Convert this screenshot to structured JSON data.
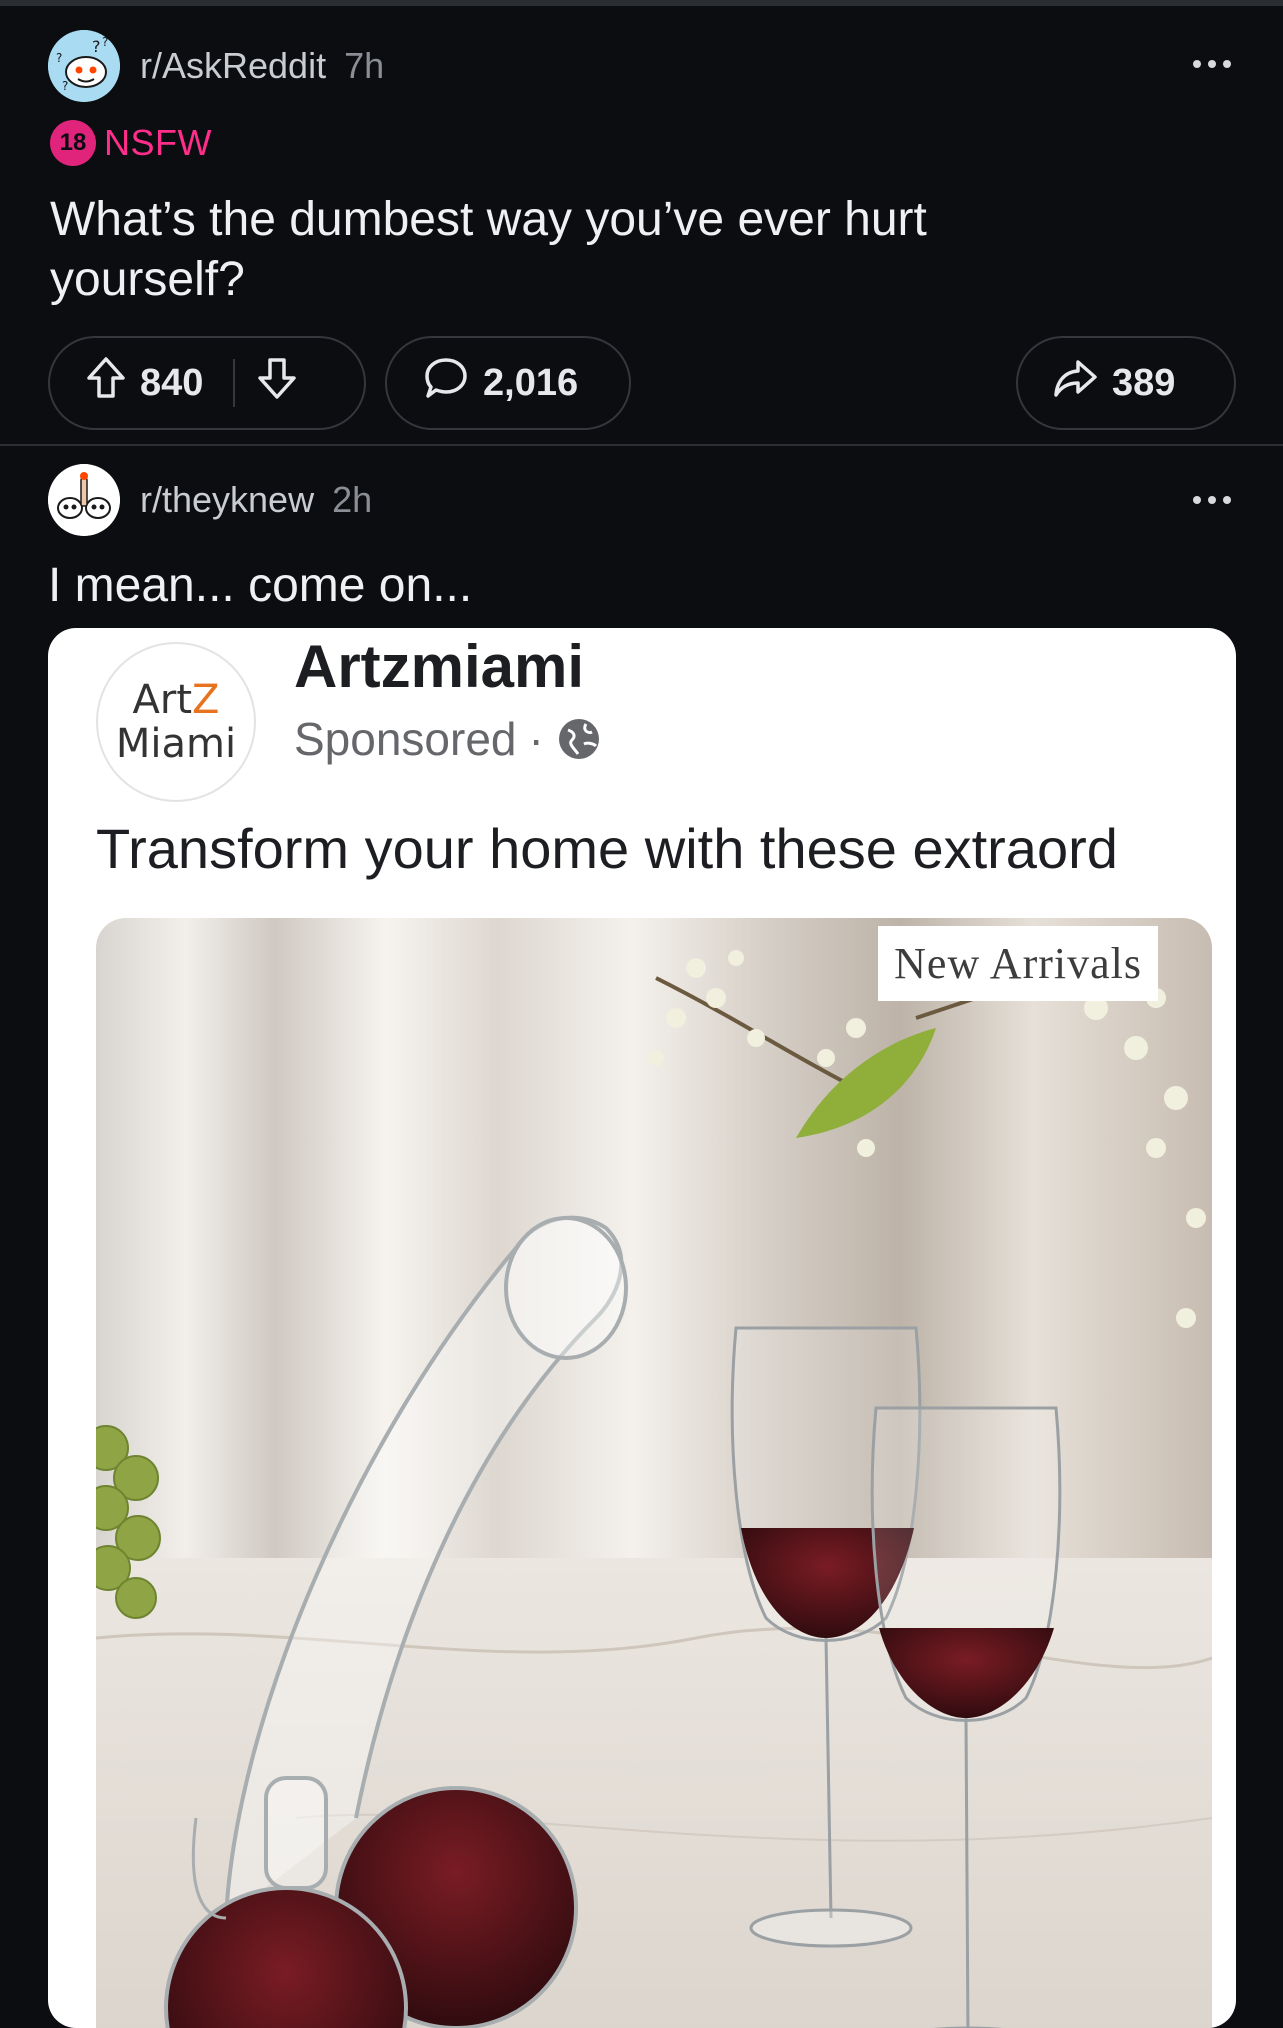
{
  "posts": [
    {
      "subreddit": "r/AskReddit",
      "age": "7h",
      "nsfw_badge": "18",
      "nsfw_label": "NSFW",
      "title": "What’s the dumbest way you’ve ever hurt yourself?",
      "upvotes": "840",
      "comments": "2,016",
      "shares": "389"
    },
    {
      "subreddit": "r/theyknew",
      "age": "2h",
      "text": "I mean... come on...",
      "ad": {
        "logo_line1_a": "Art",
        "logo_line1_b": "Z",
        "logo_line2": "Miami",
        "advertiser": "Artzmiami",
        "sponsored": "Sponsored",
        "dot": "·",
        "caption": "Transform your home with these extraord",
        "badge": "New Arrivals"
      }
    }
  ],
  "icons": {
    "more": "three-dots-icon",
    "upvote": "arrow-up-icon",
    "downvote": "arrow-down-icon",
    "comment": "speech-bubble-icon",
    "share": "share-arrow-icon",
    "globe": "globe-icon"
  },
  "colors": {
    "background": "#0b0d10",
    "nsfw": "#ff2e8b",
    "pill_border": "#34373c"
  }
}
